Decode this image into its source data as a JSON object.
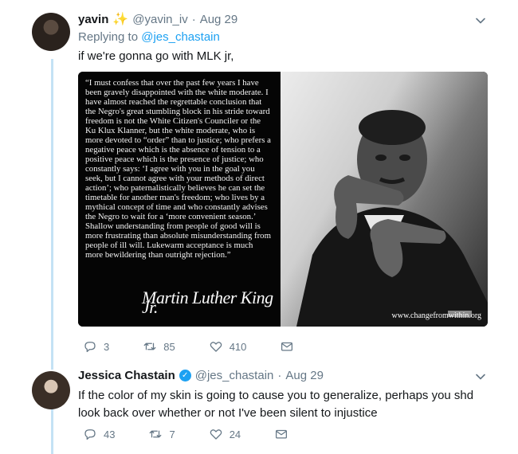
{
  "tweet1": {
    "name": "yavin",
    "name_emoji": "✨",
    "handle": "@yavin_iv",
    "separator": "·",
    "date": "Aug 29",
    "replying_label": "Replying to",
    "replying_handle": "@jes_chastain",
    "text": "if we're gonna go with MLK jr,",
    "media": {
      "quote": "“I must confess that over the past few years I have been gravely disappointed with the white moderate. I have almost reached the regrettable conclusion that the Negro's great stumbling block in his stride toward freedom is not the White Citizen's Counciler or the Ku Klux Klanner, but the white moderate, who is more devoted to “order” than to justice; who prefers a negative peace which is the absence of tension to a positive peace which is the presence of justice; who constantly says: ‘I agree with you in the goal you seek, but I cannot agree with your methods of direct action’; who paternalistically believes he can set the timetable for another man's freedom; who lives by a mythical concept of time and who constantly advises the Negro to wait for a ‘more convenient season.’ Shallow understanding from people of good will is more frustrating than absolute misunderstanding from people of ill will. Lukewarm acceptance is much more bewildering than outright rejection.”",
      "signature": "Martin Luther King Jr.",
      "watermark": "www.changefromwithin.org"
    },
    "counts": {
      "replies": "3",
      "retweets": "85",
      "likes": "410"
    }
  },
  "tweet2": {
    "name": "Jessica Chastain",
    "handle": "@jes_chastain",
    "separator": "·",
    "date": "Aug 29",
    "text": "If the color of my skin is going to cause you to generalize, perhaps you shd look back over whether or not I've been silent to injustice",
    "counts": {
      "replies": "43",
      "retweets": "7",
      "likes": "24"
    }
  },
  "icons": {
    "reply": "reply-icon",
    "retweet": "retweet-icon",
    "like": "heart-icon",
    "dm": "envelope-icon",
    "more": "chevron-down-icon",
    "verified": "verified-badge-icon"
  },
  "colors": {
    "link": "#1da1f2",
    "muted": "#657786",
    "thread": "#c4e2f5",
    "verified": "#1da1f2"
  }
}
